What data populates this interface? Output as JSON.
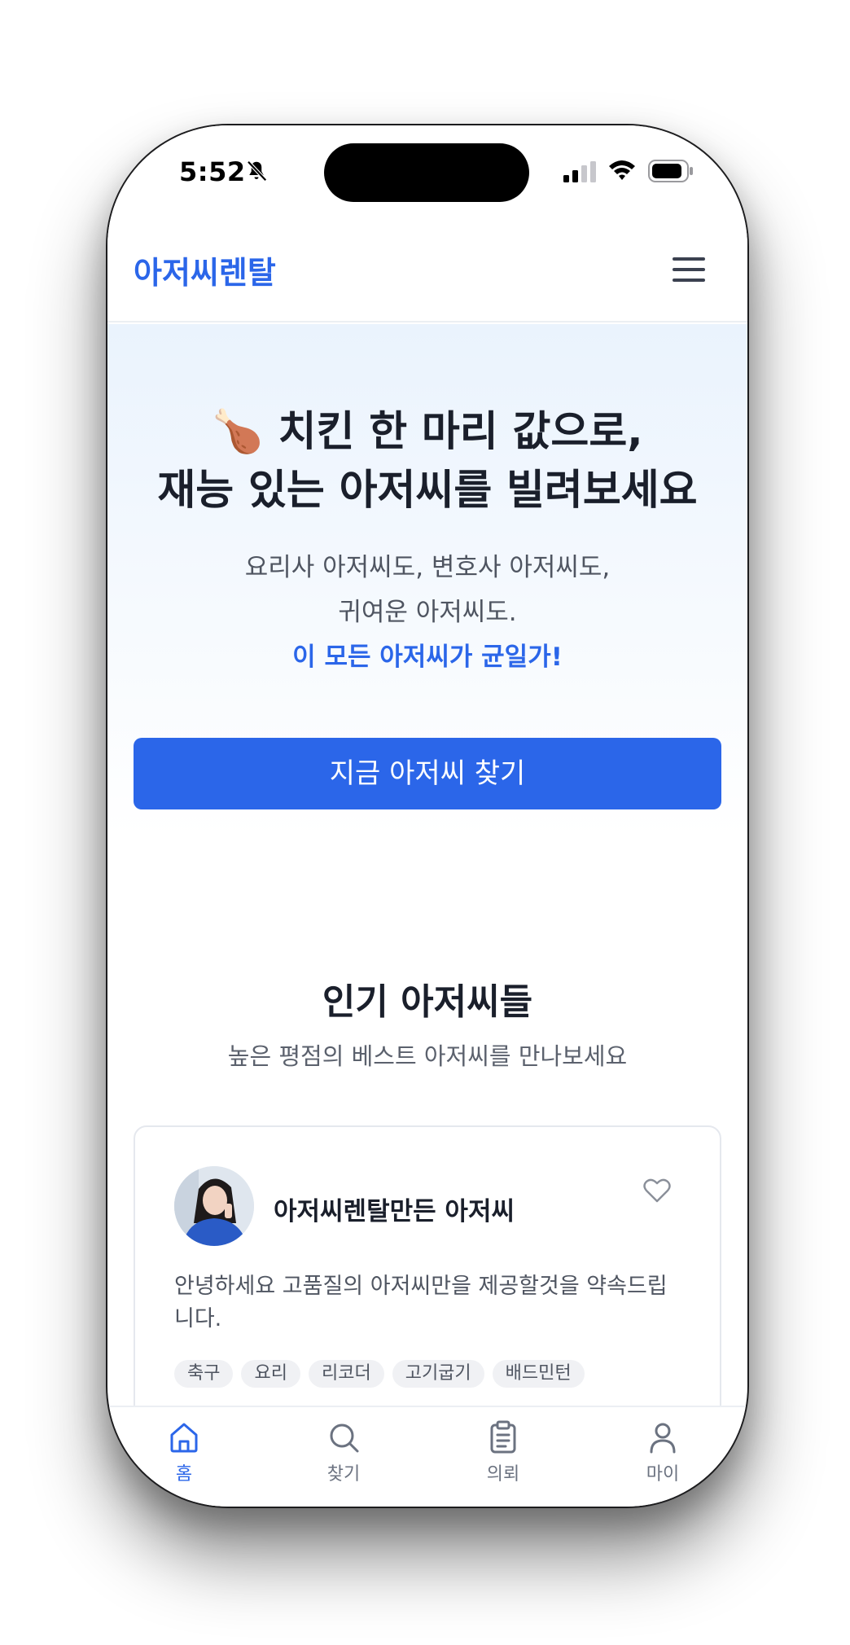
{
  "colors": {
    "accent": "#2b66e9",
    "text_dark": "#1a1f2b",
    "text_muted": "#4f5561",
    "tab_inactive": "#6b7280"
  },
  "status_bar": {
    "time": "5:52",
    "icons": [
      "bell-off-icon",
      "signal-icon",
      "wifi-icon",
      "battery-icon"
    ]
  },
  "header": {
    "brand": "아저씨렌탈",
    "menu_icon": "menu-icon"
  },
  "hero": {
    "title_line1": "🍗 치킨 한 마리 값으로,",
    "title_line2": "재능 있는 아저씨를 빌려보세요",
    "subtitle_line1": "요리사 아저씨도, 변호사 아저씨도,",
    "subtitle_line2": "귀여운 아저씨도.",
    "highlight": "이 모든 아저씨가 균일가!",
    "cta_label": "지금 아저씨 찾기"
  },
  "popular": {
    "title": "인기 아저씨들",
    "subtitle": "높은 평점의 베스트 아저씨를 만나보세요",
    "cards": [
      {
        "name": "아저씨렌탈만든 아저씨",
        "description": "안녕하세요 고품질의 아저씨만을 제공할것을 약속드립니다.",
        "tags": [
          "축구",
          "요리",
          "리코더",
          "고기굽기",
          "배드민턴"
        ],
        "favorite_icon": "heart-icon"
      }
    ]
  },
  "tab_bar": {
    "active": "홈",
    "tabs": [
      {
        "label": "홈",
        "icon": "home-icon"
      },
      {
        "label": "찾기",
        "icon": "search-icon"
      },
      {
        "label": "의뢰",
        "icon": "clipboard-icon"
      },
      {
        "label": "마이",
        "icon": "person-icon"
      }
    ]
  }
}
